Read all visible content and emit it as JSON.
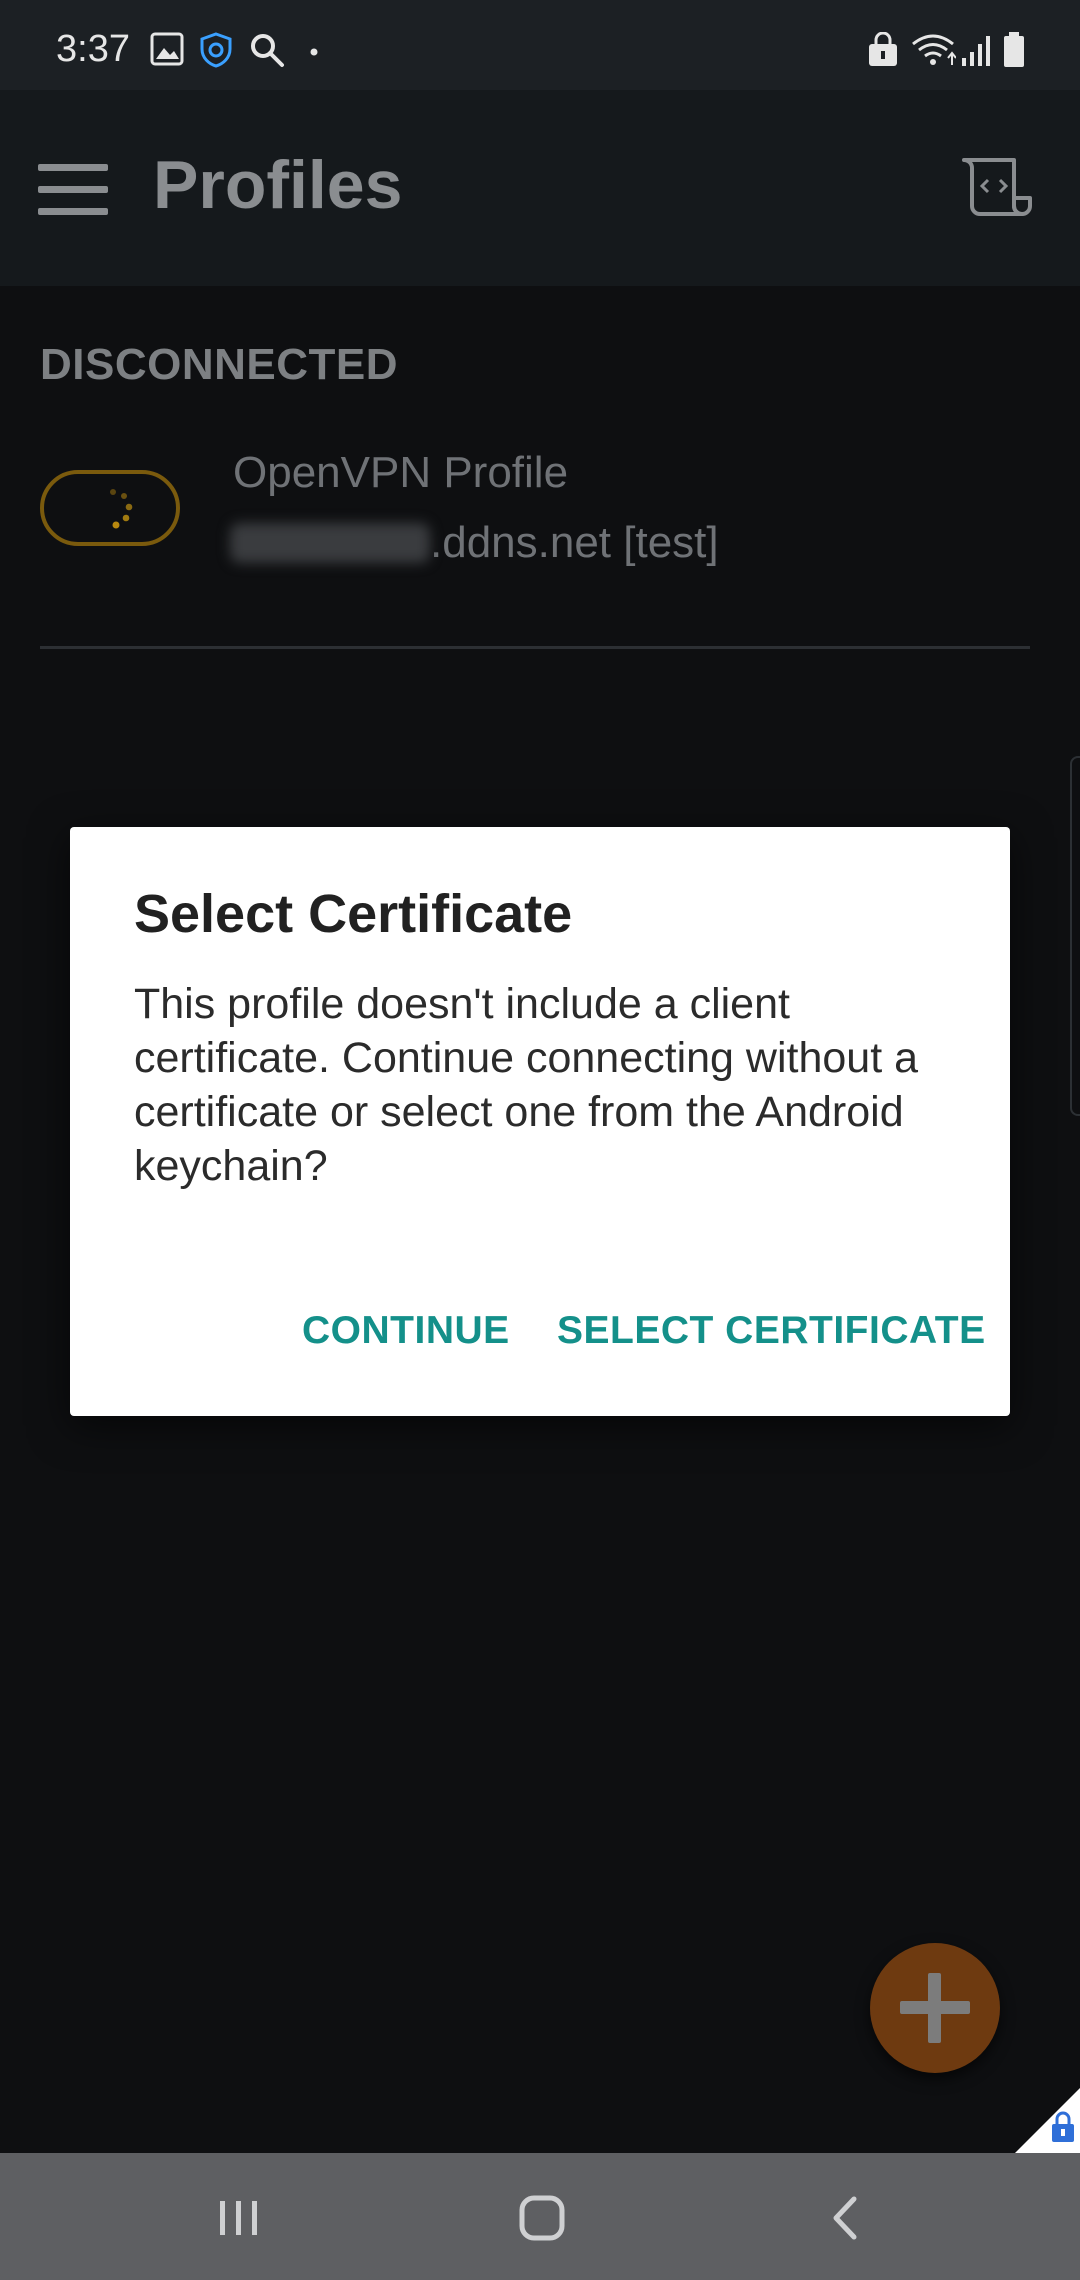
{
  "status_bar": {
    "time": "3:37",
    "left_icons": [
      "image-icon",
      "shield-icon",
      "search-icon",
      "dot-icon"
    ],
    "right_icons": [
      "lock-icon",
      "wifi-icon",
      "signal-icon",
      "battery-icon"
    ]
  },
  "app_bar": {
    "title": "Profiles",
    "menu_icon": "hamburger-menu-icon",
    "action_icon": "import-profile-icon"
  },
  "profiles_section": {
    "label": "DISCONNECTED",
    "items": [
      {
        "name": "OpenVPN Profile",
        "host_suffix": ".ddns.net [test]",
        "state": "disconnected"
      }
    ]
  },
  "dialog": {
    "title": "Select Certificate",
    "body": "This profile doesn't include a client certificate. Continue connecting without a certificate or select one from the Android keychain?",
    "buttons": {
      "continue": "CONTINUE",
      "select": "SELECT CERTIFICATE"
    }
  },
  "fab": {
    "icon": "plus-icon"
  },
  "colors": {
    "accent": "#14908a",
    "fab": "#6e3a10",
    "toggle_border": "#7a5a0d",
    "app_bar": "#15191c",
    "background": "#0e0f11"
  },
  "nav_bar": {
    "buttons": [
      "recents-icon",
      "home-icon",
      "back-icon"
    ]
  }
}
